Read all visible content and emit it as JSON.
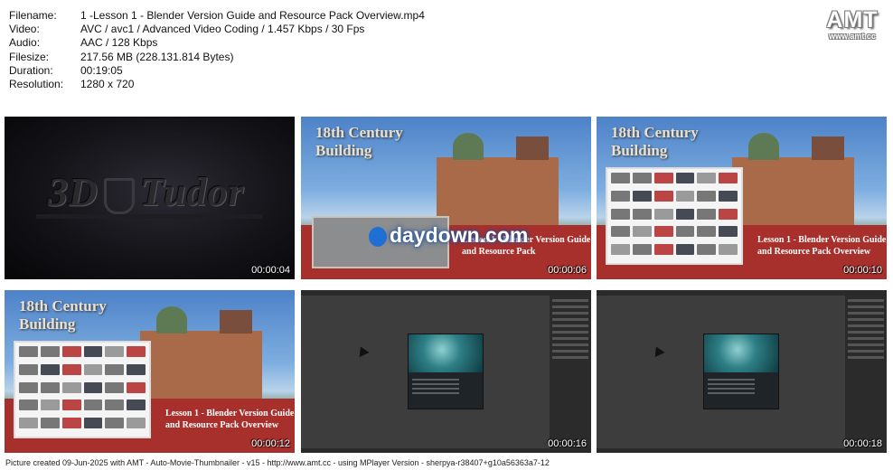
{
  "info": {
    "rows": [
      {
        "label": "Filename:",
        "value": "1 -Lesson 1 - Blender Version Guide and Resource Pack Overview.mp4"
      },
      {
        "label": "Video:",
        "value": "AVC / avc1 / Advanced Video Coding / 1.457 Kbps / 30 Fps"
      },
      {
        "label": "Audio:",
        "value": "AAC / 128 Kbps"
      },
      {
        "label": "Filesize:",
        "value": "217.56 MB (228.131.814 Bytes)"
      },
      {
        "label": "Duration:",
        "value": "00:19:05"
      },
      {
        "label": "Resolution:",
        "value": "1280 x 720"
      }
    ]
  },
  "logo": {
    "big": "AMT",
    "small": "www.amt.cc"
  },
  "thumbs": [
    {
      "timestamp": "00:00:04",
      "brand_left": "3D",
      "brand_right": "Tudor"
    },
    {
      "timestamp": "00:00:06",
      "title_line1": "18th Century",
      "title_line2": "Building",
      "red_line1": "Lesson 1 - Blender Version Guide",
      "red_line2": "and Resource Pack",
      "watermark": "daydown.com"
    },
    {
      "timestamp": "00:00:10",
      "title_line1": "18th Century",
      "title_line2": "Building",
      "red_line1": "Lesson 1 - Blender Version Guide",
      "red_line2": "and Resource Pack Overview"
    },
    {
      "timestamp": "00:00:12",
      "title_line1": "18th Century",
      "title_line2": "Building",
      "red_line1": "Lesson 1 - Blender Version Guide",
      "red_line2": "and Resource Pack Overview"
    },
    {
      "timestamp": "00:00:16"
    },
    {
      "timestamp": "00:00:18"
    }
  ],
  "footer": "Picture created 09-Jun-2025 with AMT - Auto-Movie-Thumbnailer - v15 - http://www.amt.cc - using MPlayer Version - sherpya-r38407+g10a56363a7-12"
}
